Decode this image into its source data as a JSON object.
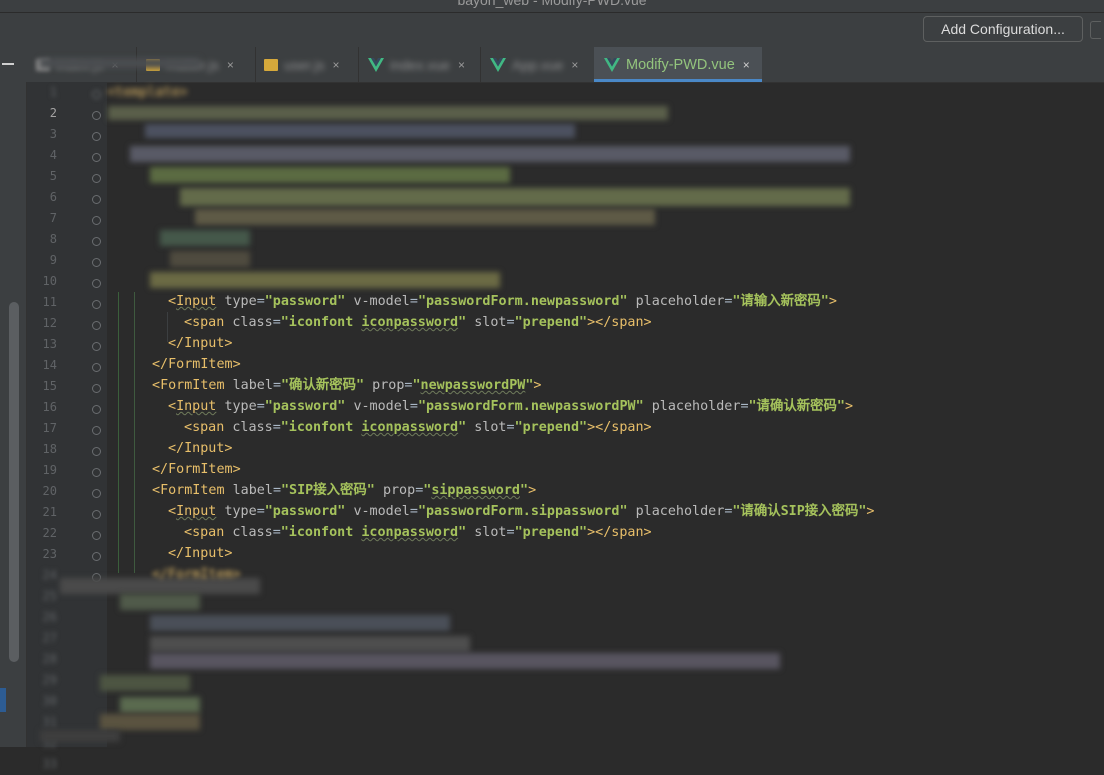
{
  "window": {
    "title": "bayon_web - Modify-PWD.vue"
  },
  "toolbar": {
    "add_configuration_label": "Add Configuration..."
  },
  "tabs": [
    {
      "label": "index.js",
      "icon": "js-file-icon",
      "active": false
    },
    {
      "label": "matter.js",
      "icon": "js-file-icon",
      "active": false
    },
    {
      "label": "user.js",
      "icon": "js-file-icon",
      "active": false
    },
    {
      "label": "index.vue",
      "icon": "vue-file-icon",
      "active": false
    },
    {
      "label": "App.vue",
      "icon": "vue-file-icon",
      "active": false
    },
    {
      "label": "Modify-PWD.vue",
      "icon": "vue-file-icon",
      "active": true
    }
  ],
  "tab_close_glyph": "×",
  "gutter": {
    "line_numbers": [
      "1",
      "2",
      "3",
      "4",
      "5",
      "6",
      "7",
      "8",
      "9",
      "10",
      "11",
      "12",
      "13",
      "14",
      "15",
      "16",
      "17",
      "18",
      "19",
      "20",
      "21",
      "22",
      "23",
      "24",
      "25",
      "26",
      "27",
      "28",
      "29",
      "30",
      "31",
      "32",
      "33"
    ],
    "current_line": "2"
  },
  "code": {
    "first_line": "<template>",
    "lines": {
      "l11": {
        "open": "<",
        "tag": "Input",
        "a1": "type",
        "v1": "\"password\"",
        "a2": "v-model",
        "v2a": "\"passwordForm.",
        "v2b": "newpassword",
        "v2c": "\"",
        "a3": "placeholder",
        "v3": "\"请输入新密码\"",
        "close": ">"
      },
      "l12": {
        "open": "<",
        "tag": "span",
        "a1": "class",
        "v1a": "\"iconfont ",
        "v1b": "iconpassword",
        "v1c": "\"",
        "a2": "slot",
        "v2": "\"prepend\"",
        "close": "></span>"
      },
      "l13": {
        "text": "</Input>"
      },
      "l14": {
        "text": "</FormItem>"
      },
      "l15": {
        "open": "<",
        "tag": "FormItem",
        "a1": "label",
        "v1": "\"确认新密码\"",
        "a2": "prop",
        "v2a": "\"",
        "v2b": "newpasswordPW",
        "v2c": "\"",
        "close": ">"
      },
      "l16": {
        "open": "<",
        "tag": "Input",
        "a1": "type",
        "v1": "\"password\"",
        "a2": "v-model",
        "v2a": "\"passwordForm.",
        "v2b": "newpasswordPW",
        "v2c": "\"",
        "a3": "placeholder",
        "v3": "\"请确认新密码\"",
        "close": ">"
      },
      "l17": {
        "open": "<",
        "tag": "span",
        "a1": "class",
        "v1a": "\"iconfont ",
        "v1b": "iconpassword",
        "v1c": "\"",
        "a2": "slot",
        "v2": "\"prepend\"",
        "close": "></span>"
      },
      "l18": {
        "text": "</Input>"
      },
      "l19": {
        "text": "</FormItem>"
      },
      "l20": {
        "open": "<",
        "tag": "FormItem",
        "a1": "label",
        "v1": "\"SIP接入密码\"",
        "a2": "prop",
        "v2a": "\"",
        "v2b": "sippassword",
        "v2c": "\"",
        "close": ">"
      },
      "l21": {
        "open": "<",
        "tag": "Input",
        "a1": "type",
        "v1": "\"password\"",
        "a2": "v-model",
        "v2a": "\"passwordForm.",
        "v2b": "sippassword",
        "v2c": "\"",
        "a3": "placeholder",
        "v3": "\"请确认SIP接入密码\"",
        "close": ">"
      },
      "l22": {
        "open": "<",
        "tag": "span",
        "a1": "class",
        "v1a": "\"iconfont ",
        "v1b": "iconpassword",
        "v1c": "\"",
        "a2": "slot",
        "v2": "\"prepend\"",
        "close": "></span>"
      },
      "l23": {
        "text": "</Input>"
      },
      "l24": {
        "text": "</FormItem>"
      }
    }
  },
  "colors": {
    "editor_bg": "#2b2b2b",
    "tag": "#e8bf6a",
    "attribute": "#bababa",
    "string": "#a5c25c",
    "active_tab_text": "#93c47d",
    "active_tab_underline": "#4a88c7"
  }
}
